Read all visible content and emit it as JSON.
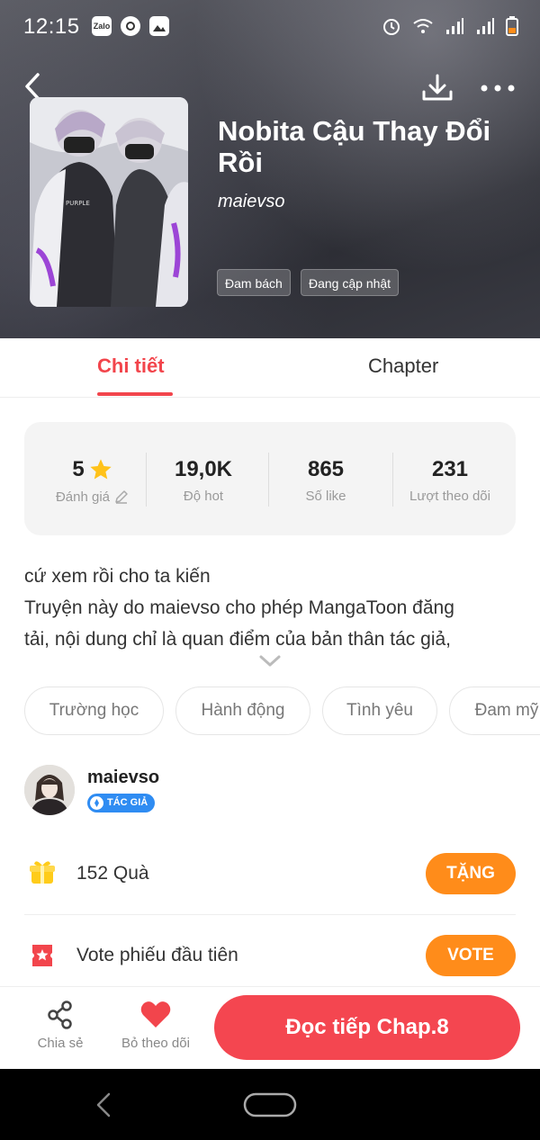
{
  "status_bar": {
    "time": "12:15",
    "left_icons": [
      "zalo-icon",
      "messenger-icon",
      "gallery-icon"
    ],
    "zalo_label": "Zalo",
    "right_icons": [
      "alarm-icon",
      "wifi-icon",
      "signal-icon",
      "signal-icon",
      "battery-icon"
    ]
  },
  "header": {
    "back_icon": "chevron-left-icon",
    "download_icon": "download-icon",
    "more_icon": "more-dots-icon"
  },
  "manga": {
    "title": "Nobita Cậu Thay Đổi Rồi",
    "author": "maievso",
    "cover_text": "PURPLE",
    "tags": [
      "Đam bách",
      "Đang cập nhật"
    ]
  },
  "tabs": [
    {
      "label": "Chi tiết",
      "active": true
    },
    {
      "label": "Chapter",
      "active": false
    }
  ],
  "stats": {
    "rating": {
      "value": "5",
      "label": "Đánh giá"
    },
    "hot": {
      "value": "19,0K",
      "label": "Độ hot"
    },
    "likes": {
      "value": "865",
      "label": "Số like"
    },
    "followers": {
      "value": "231",
      "label": "Lượt theo dõi"
    }
  },
  "description": {
    "lines": [
      "cứ xem rồi cho ta kiến",
      "Truyện này do maievso cho phép MangaToon đăng",
      "tải, nội dung chỉ là quan điểm của bản thân tác giả,"
    ]
  },
  "genres": [
    "Trường học",
    "Hành động",
    "Tình yêu",
    "Đam mỹ"
  ],
  "author_card": {
    "name": "maievso",
    "badge": "TÁC GIẢ"
  },
  "gift": {
    "count": "152",
    "unit": "Quà",
    "button": "TẶNG"
  },
  "vote": {
    "text": "Vote phiếu đầu tiên",
    "button": "VOTE"
  },
  "bottom_bar": {
    "share_label": "Chia sẻ",
    "unfollow_label": "Bỏ theo dõi",
    "read_button": "Đọc tiếp Chap.8"
  },
  "colors": {
    "accent": "#f2454c",
    "orange": "#ff8c1a",
    "star": "#ffc21a",
    "badge_blue": "#2f8cf2"
  }
}
